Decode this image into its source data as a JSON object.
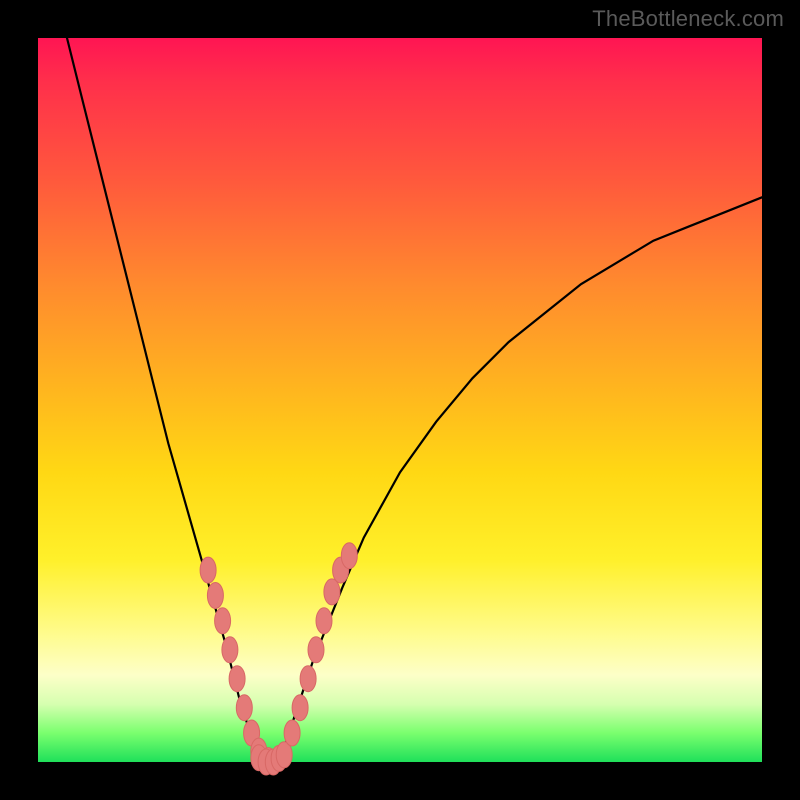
{
  "watermark": {
    "text": "TheBottleneck.com"
  },
  "colors": {
    "frame": "#000000",
    "watermark": "#5a5a5a",
    "curve_stroke": "#000000",
    "marker_fill": "#e47a78",
    "marker_stroke": "#d86865"
  },
  "chart_data": {
    "type": "line",
    "title": "",
    "xlabel": "",
    "ylabel": "",
    "xlim": [
      0,
      100
    ],
    "ylim": [
      0,
      100
    ],
    "grid": false,
    "legend": false,
    "series": [
      {
        "name": "bottleneck-curve",
        "x": [
          4,
          6,
          8,
          10,
          12,
          14,
          16,
          18,
          20,
          22,
          24,
          26,
          27,
          28,
          29,
          30,
          31,
          32,
          33,
          34,
          35,
          36,
          38,
          40,
          42,
          45,
          50,
          55,
          60,
          65,
          70,
          75,
          80,
          85,
          90,
          95,
          100
        ],
        "y": [
          100,
          92,
          84,
          76,
          68,
          60,
          52,
          44,
          37,
          30,
          23,
          16,
          12,
          8,
          5,
          2,
          0,
          0,
          0,
          2,
          5,
          8,
          14,
          19,
          24,
          31,
          40,
          47,
          53,
          58,
          62,
          66,
          69,
          72,
          74,
          76,
          78
        ]
      }
    ],
    "markers": {
      "left_branch_x": [
        23.5,
        24.5,
        25.5,
        26.5,
        27.5,
        28.5,
        29.5,
        30.5,
        31.8
      ],
      "left_branch_y": [
        26.5,
        23.0,
        19.5,
        15.5,
        11.5,
        7.5,
        4.0,
        1.5,
        0.2
      ],
      "right_branch_x": [
        34.0,
        35.1,
        36.2,
        37.3,
        38.4,
        39.5,
        40.6,
        41.8,
        43.0
      ],
      "right_branch_y": [
        1.0,
        4.0,
        7.5,
        11.5,
        15.5,
        19.5,
        23.5,
        26.5,
        28.5
      ],
      "bottom_x": [
        30.5,
        31.5,
        32.5,
        33.3
      ],
      "bottom_y": [
        0.6,
        0.0,
        0.0,
        0.5
      ]
    }
  }
}
